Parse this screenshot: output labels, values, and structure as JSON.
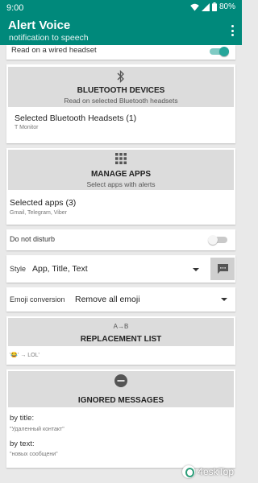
{
  "status_bar": {
    "time": "9:00",
    "battery": "80%"
  },
  "app_bar": {
    "title": "Alert Voice",
    "subtitle": "notification to speech",
    "menu_icon": "more-vert-icon"
  },
  "wired_headset": {
    "label": "Read on a wired headset",
    "enabled": true
  },
  "bluetooth": {
    "icon": "bluetooth-icon",
    "button_title": "Bluetooth devices",
    "button_subtitle": "Read on selected Bluetooth headsets",
    "selected_label": "Selected Bluetooth Headsets (1)",
    "selected_value": "T Monitor"
  },
  "apps": {
    "icon": "apps-grid-icon",
    "button_title": "Manage apps",
    "button_subtitle": "Select apps with alerts",
    "selected_label": "Selected apps (3)",
    "selected_value": "Gmail, Telegram, Viber"
  },
  "do_not_disturb": {
    "label": "Do not disturb",
    "enabled": false
  },
  "style": {
    "label": "Style",
    "value": "App, Title, Text",
    "preview_icon": "message-icon"
  },
  "emoji": {
    "label": "Emoji conversion",
    "value": "Remove all emoji"
  },
  "replacement": {
    "icon": "a-to-b-icon",
    "icon_text": "A→B",
    "button_title": "Replacement list",
    "example": "'😂' → LOL'"
  },
  "ignored": {
    "icon": "block-icon",
    "button_title": "Ignored messages",
    "by_title_label": "by title:",
    "by_title_value": "\"Удаленный контакт\"",
    "by_text_label": "by text:",
    "by_text_value": "\"новых сообщени\""
  },
  "watermark": {
    "text": "4eskTop"
  },
  "colors": {
    "primary": "#00897b",
    "background": "#e9e9e9",
    "button_grey": "#dcdcdc",
    "toggle_on": "#26a69a"
  }
}
